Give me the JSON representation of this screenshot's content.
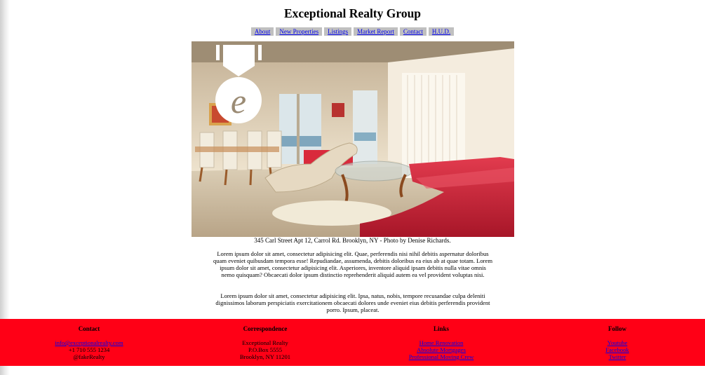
{
  "site": {
    "title": "Exceptional Realty Group"
  },
  "nav": {
    "items": [
      "About",
      "New Properties",
      "Listings",
      "Market Report",
      "Contact",
      "H.U.D."
    ]
  },
  "hero": {
    "icon": "medal-icon",
    "caption": "345 Carl Street Apt 12, Carrol Rd. Brooklyn, NY - Photo by Denise Richards."
  },
  "content": {
    "paragraphs": [
      "Lorem ipsum dolor sit amet, consectetur adipisicing elit. Quae, perferendis nisi nihil debitis aspernatur doloribus quam eveniet quibusdam tempora esse! Repudiandae, assumenda, debitis doloribus ea eius ab at quae totam. Lorem ipsum dolor sit amet, consectetur adipisicing elit. Asperiores, inventore aliquid ipsam debitis nulla vitae omnis nemo quisquam? Obcaecati dolor ipsum distinctio reprehenderit aliquid autem ea vel provident voluptas nisi.",
      "Lorem ipsum dolor sit amet, consectetur adipisicing elit. Ipsa, natus, nobis, tempore recusandae culpa deleniti dignissimos laborum perspiciatis exercitationem obcaecati dolores unde eveniet eius debitis perferendis provident porro. Ipsum, placeat."
    ]
  },
  "footer": {
    "background": "#ff0016",
    "contact": {
      "heading": "Contact",
      "email": "info@exceptionalrealty.com",
      "phone": "+1 710 555 1234",
      "handle": "@fakeRealty"
    },
    "correspondence": {
      "heading": "Correspondence",
      "lines": [
        "Exceptional Realty",
        "P.O.Box 5555",
        "Brooklyn, NY 11201"
      ]
    },
    "links": {
      "heading": "Links",
      "items": [
        "Home Renovation",
        "Absolute Mortgages",
        "Professional Moving Crew"
      ]
    },
    "follow": {
      "heading": "Follow",
      "items": [
        "Youtube",
        "Facebook",
        "Twitter"
      ]
    }
  }
}
